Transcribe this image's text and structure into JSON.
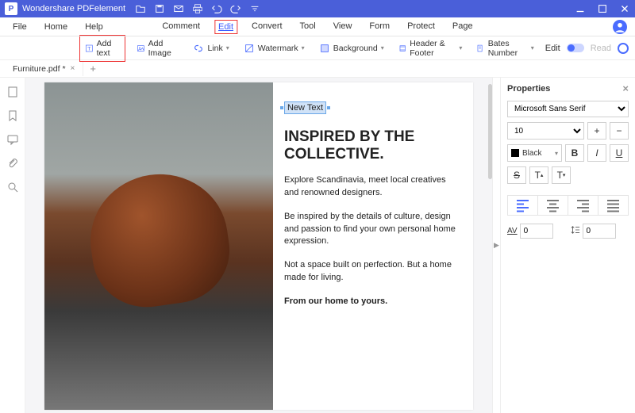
{
  "app": {
    "title": "Wondershare PDFelement"
  },
  "menus": {
    "left": [
      "File",
      "Home",
      "Help"
    ],
    "center": [
      "Comment",
      "Edit",
      "Convert",
      "Tool",
      "View",
      "Form",
      "Protect",
      "Page"
    ],
    "highlighted": "Edit"
  },
  "toolbar": {
    "add_text": "Add text",
    "add_text_highlighted": true,
    "add_image": "Add Image",
    "link": "Link",
    "watermark": "Watermark",
    "background": "Background",
    "header_footer": "Header & Footer",
    "bates": "Bates Number",
    "mode_edit": "Edit",
    "mode_read": "Read"
  },
  "tabs": {
    "active": "Furniture.pdf *"
  },
  "document": {
    "new_text": "New Text",
    "heading": "INSPIRED BY THE COLLECTIVE.",
    "p1": "Explore Scandinavia, meet local creatives and renowned designers.",
    "p2": "Be inspired by the details of culture, design and passion to find your own personal home expression.",
    "p3": "Not a space built on perfection. But a home made for living.",
    "p4": "From our home to yours."
  },
  "properties": {
    "title": "Properties",
    "font": "Microsoft Sans Serif",
    "size": "10",
    "color": "Black",
    "letter_spacing": "0",
    "line_spacing": "0"
  }
}
